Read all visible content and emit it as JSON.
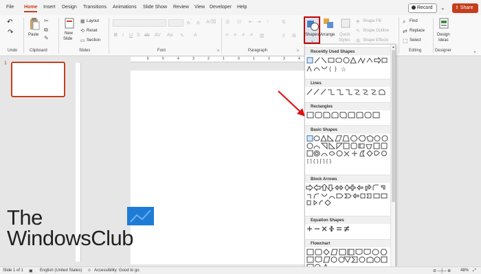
{
  "menu": {
    "tabs": [
      "File",
      "Home",
      "Insert",
      "Design",
      "Transitions",
      "Animations",
      "Slide Show",
      "Review",
      "View",
      "Developer",
      "Help"
    ],
    "active": "Home",
    "record_label": "Record",
    "share_label": "Share"
  },
  "ribbon": {
    "groups": {
      "undo": "Undo",
      "clipboard": "Clipboard",
      "slides": "Slides",
      "font": "Font",
      "paragraph": "Paragraph",
      "editing": "Editing",
      "designer": "Designer"
    },
    "paste": "Paste",
    "new_slide": [
      "New",
      "Slide"
    ],
    "layout": "Layout",
    "reset": "Reset",
    "section": "Section",
    "shapes": "Shapes",
    "arrange": "Arrange",
    "quick_styles": [
      "Quick",
      "Styles"
    ],
    "shape_fill": "Shape Fill",
    "shape_outline": "Shape Outline",
    "shape_effects": "Shape Effects",
    "find": "Find",
    "replace": "Replace",
    "select": "Select",
    "design_ideas": [
      "Design",
      "Ideas"
    ]
  },
  "ruler": {
    "marks": [
      "6",
      "5",
      "4",
      "3",
      "2",
      "1",
      "0",
      "1",
      "2",
      "3",
      "4"
    ]
  },
  "slides_panel": {
    "number": "1"
  },
  "gallery": {
    "sections": [
      "Recently Used Shapes",
      "Lines",
      "Rectangles",
      "Basic Shapes",
      "Block Arrows",
      "Equation Shapes",
      "Flowchart"
    ]
  },
  "watermark": {
    "line1": "The",
    "line2": "WindowsClub"
  },
  "status": {
    "slide": "Slide 1 of 1",
    "language": "English (United States)",
    "accessibility": "Accessibility: Good to go",
    "zoom": "48%"
  },
  "colors": {
    "accent": "#c43e1c",
    "highlight": "#c00000",
    "arrow": "#e01010",
    "watermark_square": "#1e7bd6"
  }
}
